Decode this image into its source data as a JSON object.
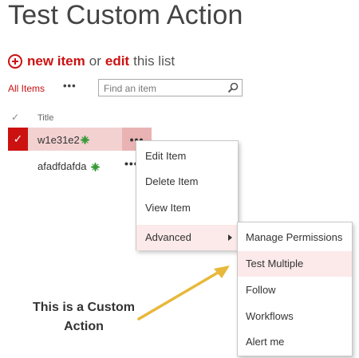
{
  "page": {
    "title": "Test Custom Action"
  },
  "toolbar": {
    "new_item": "new item",
    "or": "or",
    "edit": "edit",
    "this_list": "this list"
  },
  "views": {
    "all_items": "All Items",
    "more": "•••"
  },
  "search": {
    "placeholder": "Find an item"
  },
  "list": {
    "column_title": "Title",
    "check_glyph": "✓",
    "rows": [
      {
        "title": "w1e31e2",
        "selected": true
      },
      {
        "title": "afadfdafda",
        "selected": false
      }
    ],
    "ellipsis": "•••"
  },
  "context_menu": {
    "items": [
      "Edit Item",
      "Delete Item",
      "View Item",
      "Advanced"
    ]
  },
  "advanced_menu": {
    "items": [
      "Manage Permissions",
      "Test Multiple",
      "Follow",
      "Workflows",
      "Alert me"
    ]
  },
  "callout": {
    "line1": "This is a Custom",
    "line2": "Action"
  },
  "colors": {
    "accent": "#cc1111",
    "new_badge": "#3a9a3a",
    "arrow": "#e8b83a",
    "highlight": "#fce9e9"
  }
}
